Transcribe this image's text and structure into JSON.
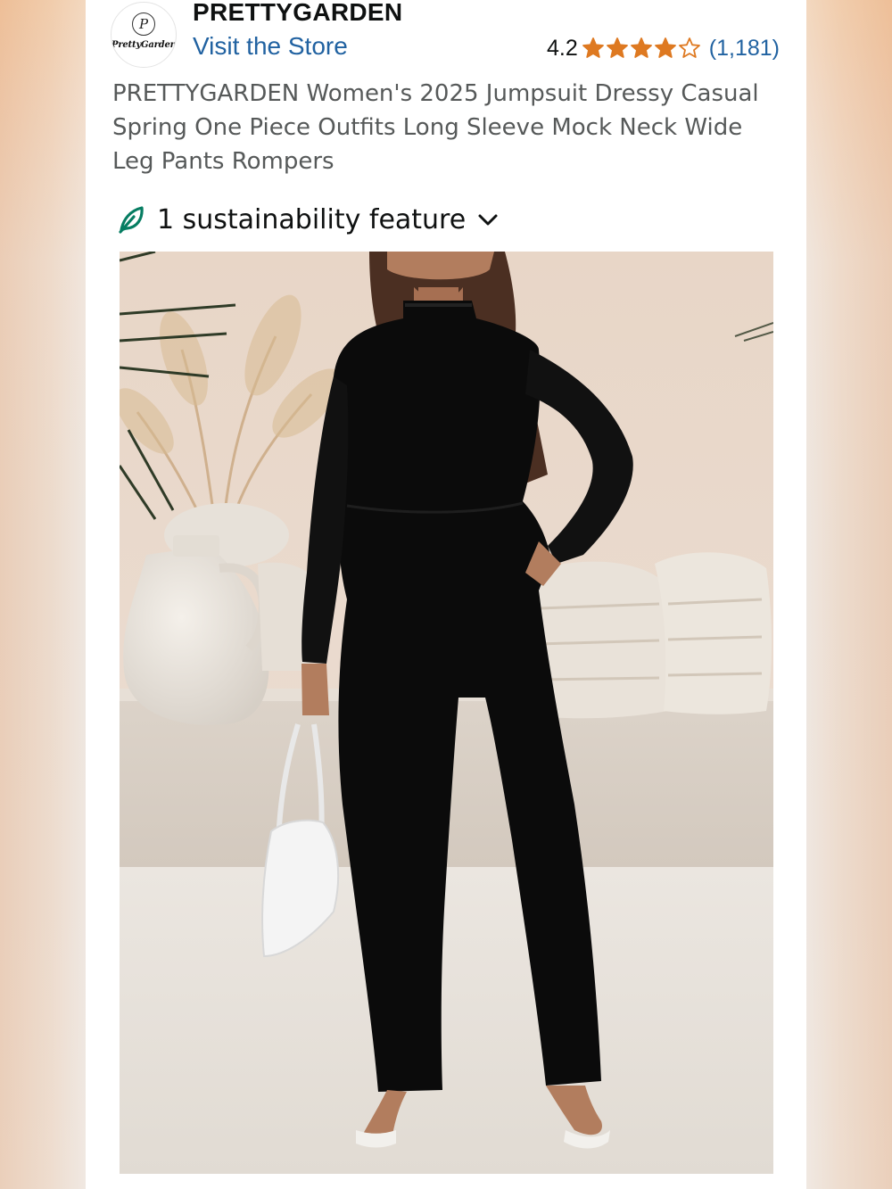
{
  "store": {
    "logo_text": "PrettyGarden",
    "brand_name": "PRETTYGARDEN",
    "visit_link": "Visit the Store"
  },
  "rating": {
    "value": "4.2",
    "stars_filled": 4,
    "stars_total": 5,
    "count": "(1,181)",
    "star_color": "#de7921"
  },
  "product": {
    "title": "PRETTYGARDEN Women's 2025 Jumpsuit Dressy Casual Spring One Piece Outfits Long Sleeve Mock Neck Wide Leg Pants Rompers"
  },
  "sustainability": {
    "label": "1 sustainability feature",
    "icon": "leaf-icon",
    "accent": "#067d62"
  },
  "image": {
    "subject": "product-photo"
  },
  "colors": {
    "link": "#2162a1",
    "text_primary": "#0f1111",
    "text_secondary": "#565959"
  }
}
